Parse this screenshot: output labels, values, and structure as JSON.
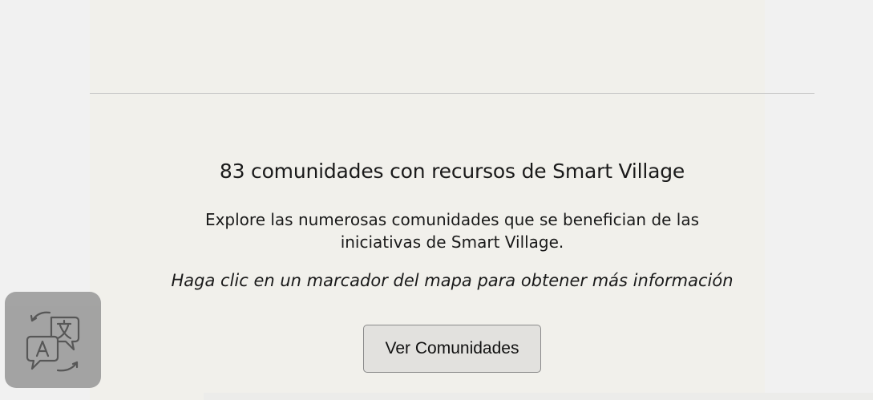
{
  "section": {
    "heading": "83 comunidades con recursos de Smart Village",
    "description": "Explore las numerosas comunidades que se benefician de las iniciativas de Smart Village.",
    "hint": "Haga clic en un marcador del mapa para obtener más información",
    "button_label": "Ver Comunidades"
  },
  "translate_widget": {
    "icon": "translate-icon"
  }
}
